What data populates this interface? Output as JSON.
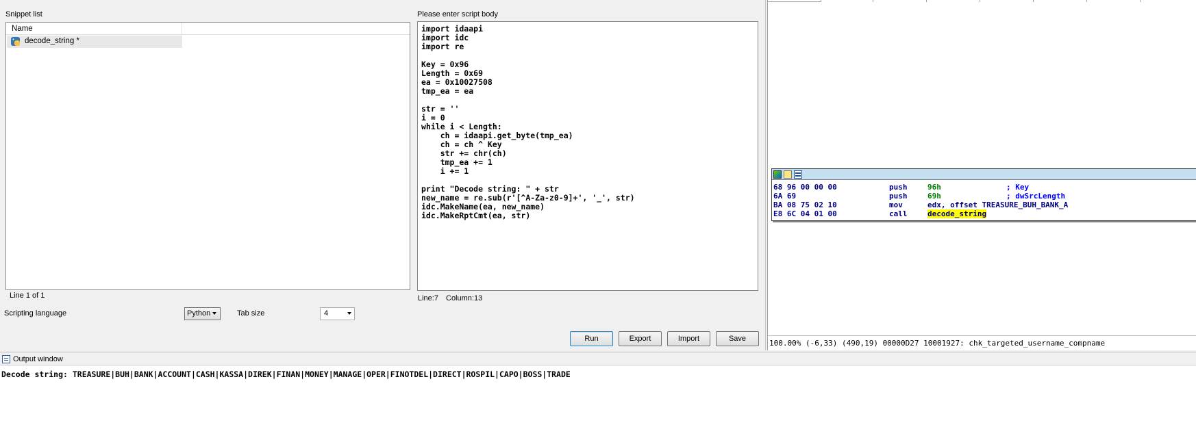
{
  "snippet_list": {
    "title": "Snippet list",
    "column_name": "Name",
    "items": [
      {
        "name": "decode_string *",
        "icon": "python-snippet-icon"
      }
    ],
    "status": "Line 1 of 1"
  },
  "script_body": {
    "title": "Please enter script body",
    "lines": [
      "import idaapi",
      "import idc",
      "import re",
      "",
      "Key = 0x96",
      "Length = 0x69",
      "ea = 0x10027508",
      "tmp_ea = ea",
      "",
      "str = ''",
      "i = 0",
      "while i < Length:",
      "    ch = idaapi.get_byte(tmp_ea)",
      "    ch = ch ^ Key",
      "    str += chr(ch)",
      "    tmp_ea += 1",
      "    i += 1",
      "",
      "print \"Decode string: \" + str",
      "new_name = re.sub(r'[^A-Za-z0-9]+', '_', str)",
      "idc.MakeName(ea, new_name)",
      "idc.MakeRptCmt(ea, str)"
    ],
    "line_status": "Line:7",
    "column_status": "Column:13"
  },
  "options": {
    "scripting_language_label": "Scripting language",
    "scripting_language_value": "Python",
    "tab_size_label": "Tab size",
    "tab_size_value": "4"
  },
  "buttons": {
    "run": "Run",
    "export": "Export",
    "import": "Import",
    "save": "Save"
  },
  "disassembly": {
    "lines": [
      {
        "bytes": "68 96 00 00 00",
        "mnem": "push",
        "operand": "96h",
        "comment": "; Key"
      },
      {
        "bytes": "6A 69",
        "mnem": "push",
        "operand": "69h",
        "comment": "; dwSrcLength"
      },
      {
        "bytes": "BA 08 75 02 10",
        "mnem": "mov",
        "operand": "edx, offset TREASURE_BUH_BANK_A",
        "comment": ""
      },
      {
        "bytes": "E8 6C 04 01 00",
        "mnem": "call",
        "operand": "decode_string",
        "comment": ""
      }
    ],
    "status": "100.00% (-6,33) (490,19) 00000D27 10001927: chk_targeted_username_compname"
  },
  "output": {
    "title": "Output window",
    "text": "Decode string: TREASURE|BUH|BANK|ACCOUNT|CASH|KASSA|DIREK|FINAN|MONEY|MANAGE|OPER|FINOTDEL|DIRECT|ROSPIL|CAPO|BOSS|TRADE"
  },
  "colors": {
    "highlight": "#ffff00",
    "graph_header": "#c4dff0",
    "code_navy": "#000080",
    "operand_green": "#008000"
  }
}
